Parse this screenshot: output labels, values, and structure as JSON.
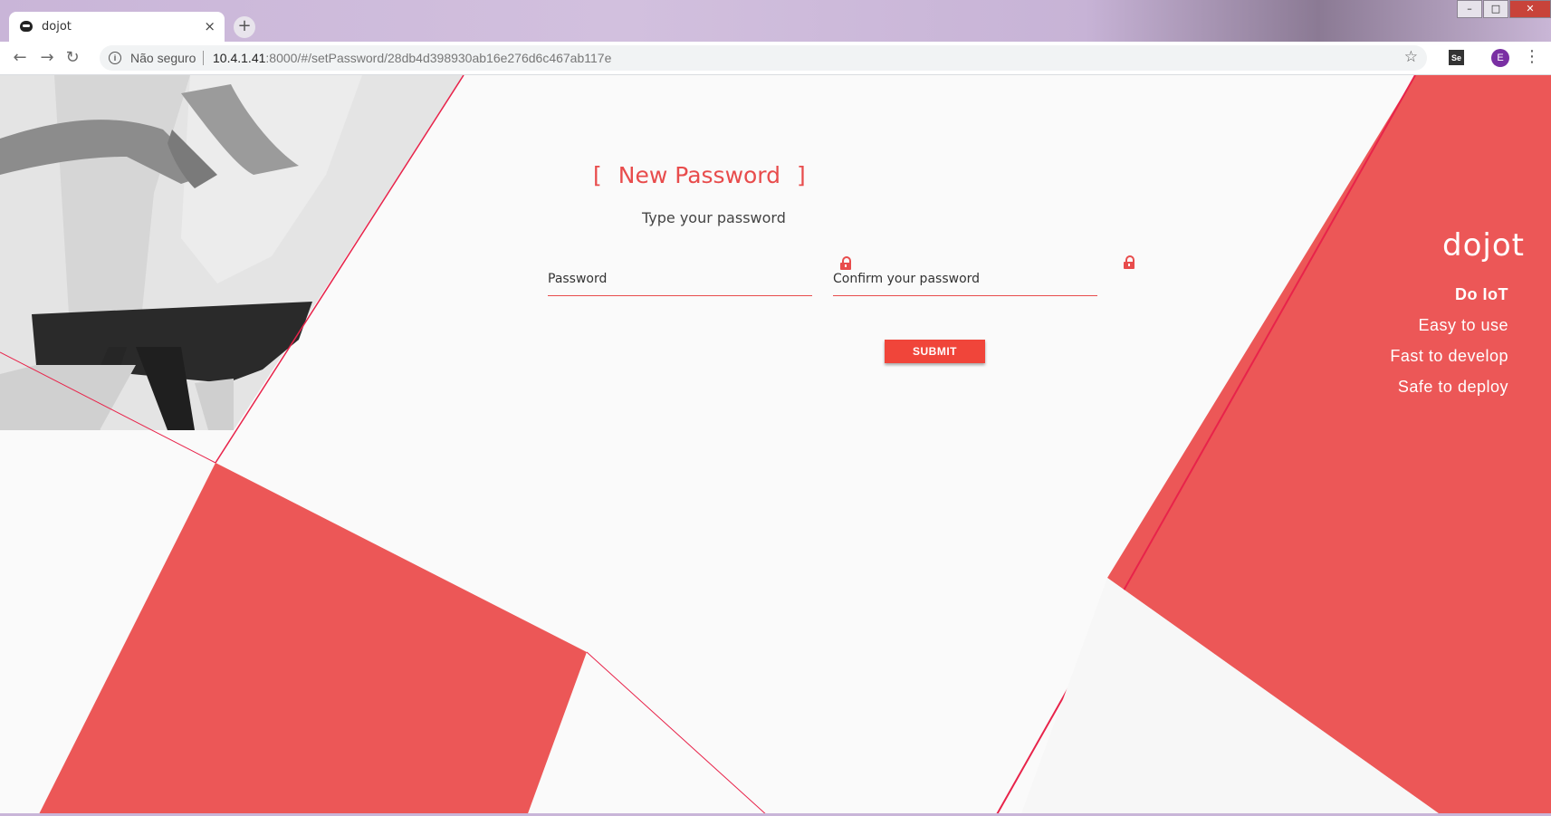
{
  "browser": {
    "tab_title": "dojot",
    "tab_close": "×",
    "new_tab": "+",
    "security_label": "Não seguro",
    "url_host": "10.4.1.41",
    "url_rest": ":8000/#/setPassword/28db4d398930ab16e276d6c467ab117e",
    "profile_initial": "E",
    "extension_label": "Se",
    "window_controls": {
      "minimize": "–",
      "maximize": "□",
      "close": "✕"
    },
    "nav": {
      "back": "←",
      "forward": "→",
      "reload": "↻",
      "star": "☆",
      "menu": "⋮"
    }
  },
  "form": {
    "title": "New Password",
    "bracket_open": "[",
    "bracket_close": "]",
    "subtitle": "Type your password",
    "password_placeholder": "Password",
    "confirm_placeholder": "Confirm your password",
    "submit_label": "SUBMIT"
  },
  "brand": {
    "logo": "dojot",
    "taglines": [
      "Do IoT",
      "Easy to use",
      "Fast to develop",
      "Safe to deploy"
    ]
  },
  "colors": {
    "accent": "#e84c4c",
    "button": "#f0453a",
    "panel": "#ec5757"
  }
}
